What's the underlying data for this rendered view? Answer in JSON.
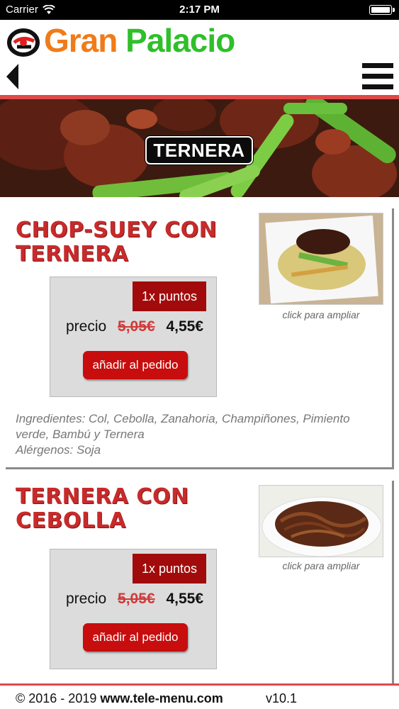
{
  "status_bar": {
    "carrier": "Carrier",
    "time": "2:17 PM",
    "icons": [
      "wifi-icon",
      "battery-icon"
    ]
  },
  "header": {
    "logo_word1": "Gran",
    "logo_word2": "Palacio",
    "back_icon": "back-arrow-icon",
    "menu_icon": "hamburger-menu-icon",
    "colors": {
      "accent_orange": "#f07b19",
      "accent_green": "#2fbf2a",
      "divider_red": "#e04848"
    }
  },
  "category": {
    "title": "TERNERA"
  },
  "items": [
    {
      "title": "CHOP-SUEY CON TERNERA",
      "points": "1x puntos",
      "price_label": "precio",
      "old_price": "5,05€",
      "new_price": "4,55€",
      "add_button": "añadir al pedido",
      "image_caption": "click para ampliar",
      "ingredients": "Ingredientes: Col, Cebolla, Zanahoria, Champiñones, Pimiento verde, Bambú y Ternera",
      "allergens": "Alérgenos: Soja"
    },
    {
      "title": "TERNERA CON CEBOLLA",
      "points": "1x puntos",
      "price_label": "precio",
      "old_price": "5,05€",
      "new_price": "4,55€",
      "add_button": "añadir al pedido",
      "image_caption": "click para ampliar"
    }
  ],
  "footer": {
    "copyright_prefix": "© 2016 - 2019 ",
    "site": "www.tele-menu.com",
    "version": "v10.1"
  }
}
